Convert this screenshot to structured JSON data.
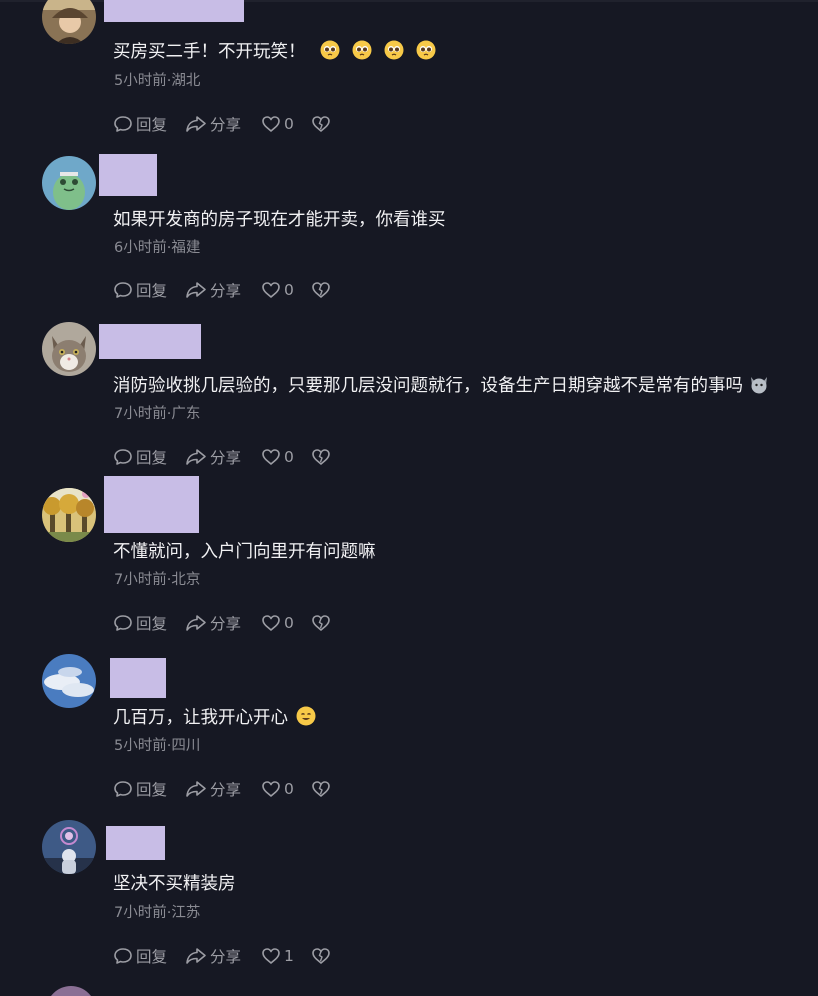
{
  "actions": {
    "reply_label": "回复",
    "share_label": "分享"
  },
  "colors": {
    "background": "#161823",
    "name_placeholder": "#c8bde6",
    "text": "#f1f1f3",
    "meta": "#8a8b93",
    "action": "#9c9da4"
  },
  "comments": [
    {
      "text": "买房买二手！不开玩笑！",
      "emojis": [
        "pleading-face",
        "pleading-face",
        "pleading-face",
        "pleading-face"
      ],
      "meta": "5小时前·湖北",
      "likes": "0",
      "avatar_icon": "woman-hat-avatar"
    },
    {
      "text": "如果开发商的房子现在才能开卖，你看谁买",
      "emojis": [],
      "meta": "6小时前·福建",
      "likes": "0",
      "avatar_icon": "green-frog-avatar"
    },
    {
      "text": "消防验收挑几层验的，只要那几层没问题就行，设备生产日期穿越不是常有的事吗",
      "emojis": [
        "cat-face"
      ],
      "meta": "7小时前·广东",
      "likes": "0",
      "avatar_icon": "cat-avatar"
    },
    {
      "text": "不懂就问，入户门向里开有问题嘛",
      "emojis": [],
      "meta": "7小时前·北京",
      "likes": "0",
      "avatar_icon": "autumn-trees-avatar"
    },
    {
      "text": "几百万，让我开心开心",
      "emojis": [
        "grinning-face"
      ],
      "meta": "5小时前·四川",
      "likes": "0",
      "avatar_icon": "sky-clouds-avatar"
    },
    {
      "text": "坚决不买精装房",
      "emojis": [],
      "meta": "7小时前·江苏",
      "likes": "1",
      "avatar_icon": "astronaut-avatar"
    }
  ]
}
